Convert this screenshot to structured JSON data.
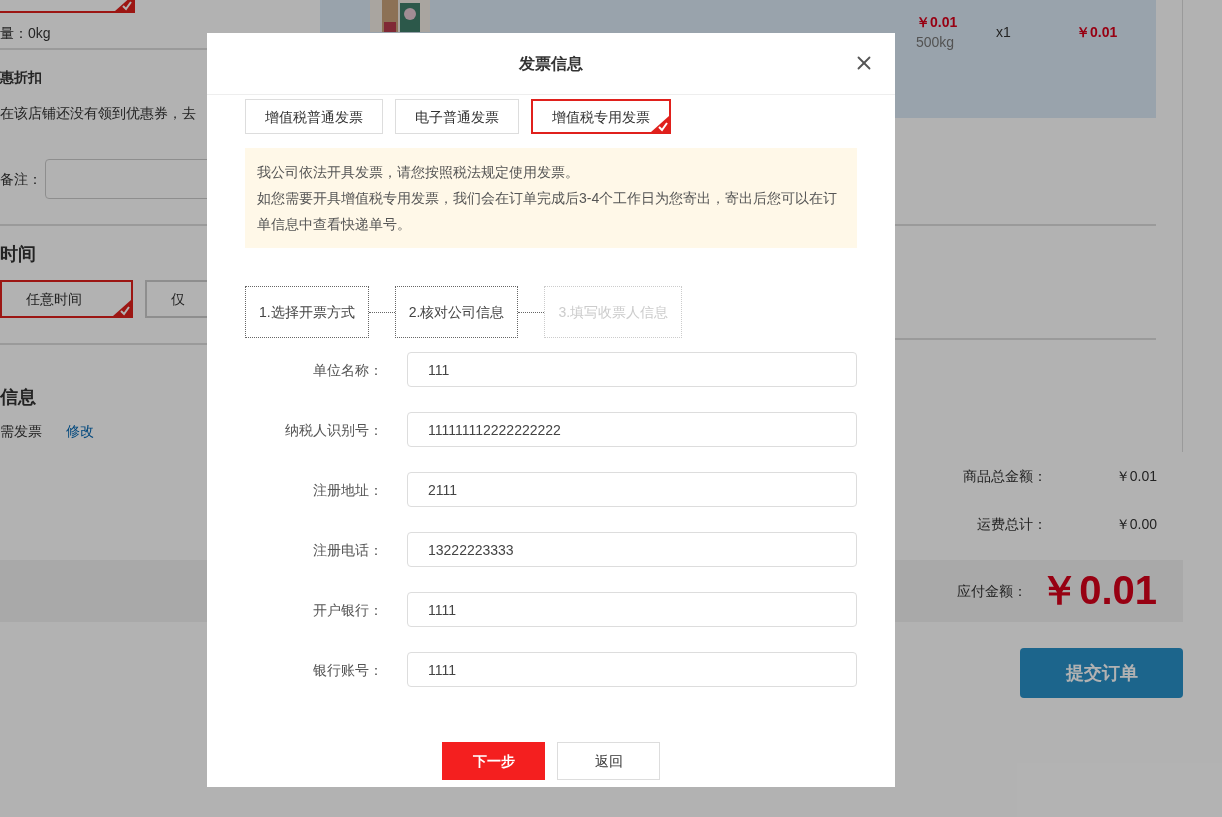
{
  "page": {
    "weight_label": "量：0kg",
    "discount_heading": "惠折扣",
    "coupon_text": "在该店铺还没有领到优惠券，去",
    "remark_label": "备注：",
    "time_heading": "时间",
    "time_options": [
      {
        "label": "任意时间",
        "selected": true
      },
      {
        "label": "仅",
        "selected": false
      }
    ],
    "invoice_heading": "信息",
    "invoice_value": "需发票",
    "invoice_edit": "修改",
    "product": {
      "price": "￥0.01",
      "weight": "500kg",
      "qty": "x1",
      "subtotal": "￥0.01"
    },
    "summary": [
      {
        "label": "商品总金额：",
        "value": "￥0.01"
      },
      {
        "label": "运费总计：",
        "value": "￥0.00"
      }
    ],
    "payable": {
      "label": "应付金额：",
      "value": "￥0.01"
    },
    "submit": "提交订单"
  },
  "dialog": {
    "title": "发票信息",
    "tabs": [
      {
        "label": "增值税普通发票",
        "selected": false
      },
      {
        "label": "电子普通发票",
        "selected": false
      },
      {
        "label": "增值税专用发票",
        "selected": true
      }
    ],
    "notice": [
      "我公司依法开具发票，请您按照税法规定使用发票。",
      "如您需要开具增值税专用发票，我们会在订单完成后3-4个工作日为您寄出，寄出后您可以在订单信息中查看快递单号。"
    ],
    "steps": [
      {
        "label": "1.选择开票方式",
        "disabled": false
      },
      {
        "label": "2.核对公司信息",
        "disabled": false
      },
      {
        "label": "3.填写收票人信息",
        "disabled": true
      }
    ],
    "fields": [
      {
        "label": "单位名称：",
        "value": "111"
      },
      {
        "label": "纳税人识别号：",
        "value": "111111112222222222"
      },
      {
        "label": "注册地址：",
        "value": "2111"
      },
      {
        "label": "注册电话：",
        "value": "13222223333"
      },
      {
        "label": "开户银行：",
        "value": "1111"
      },
      {
        "label": "银行账号：",
        "value": "1111"
      }
    ],
    "buttons": [
      {
        "label": "下一步",
        "kind": "primary"
      },
      {
        "label": "返回",
        "kind": "default"
      }
    ]
  }
}
